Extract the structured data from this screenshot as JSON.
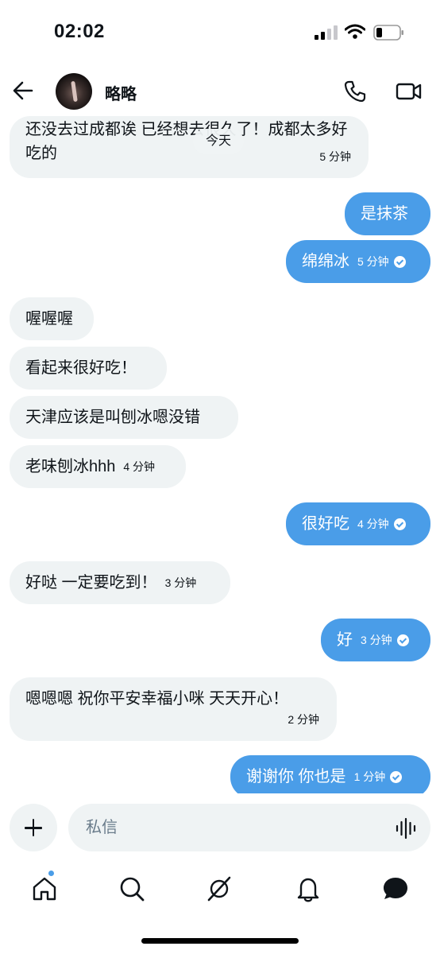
{
  "status_bar": {
    "time": "02:02"
  },
  "header": {
    "name": "略略"
  },
  "chat": {
    "date_label": "今天",
    "messages": [
      {
        "dir": "in",
        "text": "还没去过成都诶 已经想去很久了！成都太多好吃的",
        "time": "5 分钟"
      },
      {
        "dir": "out",
        "text": "是抹茶",
        "time": ""
      },
      {
        "dir": "out",
        "text": "绵绵冰",
        "time": "5 分钟"
      },
      {
        "dir": "in",
        "text": "喔喔喔",
        "time": ""
      },
      {
        "dir": "in",
        "text": "看起来很好吃！",
        "time": ""
      },
      {
        "dir": "in",
        "text": "天津应该是叫刨冰嗯没错",
        "time": ""
      },
      {
        "dir": "in",
        "text": "老味刨冰hhh",
        "time": "4 分钟"
      },
      {
        "dir": "out",
        "text": "很好吃",
        "time": "4 分钟"
      },
      {
        "dir": "in",
        "text": "好哒 一定要吃到！",
        "time": "3 分钟"
      },
      {
        "dir": "out",
        "text": "好",
        "time": "3 分钟"
      },
      {
        "dir": "in",
        "text": "嗯嗯嗯 祝你平安幸福小咪 天天开心！",
        "time": "2 分钟"
      },
      {
        "dir": "out",
        "text": "谢谢你 你也是",
        "time": "1 分钟"
      }
    ]
  },
  "composer": {
    "placeholder": "私信"
  },
  "tabbar": {
    "items": [
      "home-icon",
      "search-icon",
      "grok-icon",
      "notifications-icon",
      "messages-icon"
    ]
  },
  "colors": {
    "accent": "#4a9de8",
    "bubble_in": "#eff3f4",
    "text": "#0f1419"
  }
}
